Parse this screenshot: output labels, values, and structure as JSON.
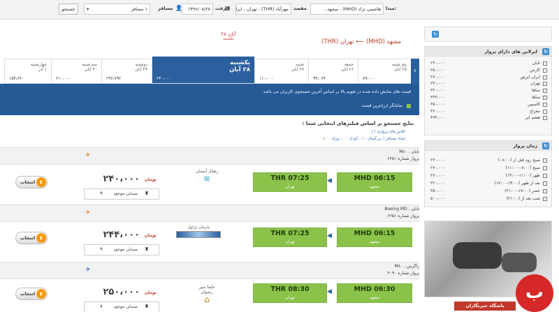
{
  "search": {
    "origin_label": "مبدا:",
    "origin_value": "هاشمی نژاد (MHD) ، مشهد ،",
    "dest_label": "مقصد",
    "dest_value": "مهرآباد (THR) ، تهران ، ایران",
    "depart_label": "رفت",
    "depart_value": "۱۳۹۶/۰۸/۲۸",
    "pax_label": "مسافر",
    "pax_value": "۱ مسافر",
    "search_button": "جستجو"
  },
  "route": {
    "title": "مشهد (MHD) ⟵ تهران (THR)",
    "date_day": "۲۸ آبان",
    "date_weekday": "یکشنبه"
  },
  "date_tabs": [
    {
      "weekday": "پنج شنبه",
      "date": "۲۵ آبان",
      "price": "۸۹،۰۰۰"
    },
    {
      "weekday": "جمعه",
      "date": "۲۶ آبان",
      "price": "۹۹،۰۶۴"
    },
    {
      "weekday": "شنبه",
      "date": "۲۷ آبان",
      "price": "۱۱۰،۰۰۰"
    },
    {
      "weekday": "یکشنبه",
      "date": "۲۸ آبان",
      "price": "۲۴۰،۰۰۰"
    },
    {
      "weekday": "دوشنبه",
      "date": "۲۹ آبان",
      "price": "۲۹۶،۷۹۲"
    },
    {
      "weekday": "سه شنبه",
      "date": "۳۰ آبان",
      "price": "۲۱۰،۰۰۰"
    },
    {
      "weekday": "چهارشنبه",
      "date": "۱ آذر",
      "price": "۱۵۴،۳۶۰"
    }
  ],
  "info": {
    "notice": "قیمت های نمایش داده شده در تقویم بالا بر اساس آخرین جستجوی کاربران می باشد.",
    "legend": "نمایانگر ارزانترین قیمت"
  },
  "results": {
    "heading": "نتایج جستجو بر اساس فیلترهای انتخابی شما :",
    "filter1": "کلاس های پروازی (  )",
    "filter2": "تعداد مسافر ( بزرگسال : ۱ ، کودک : ۰ ، نوزاد : ۰ )"
  },
  "flights": [
    {
      "aircraft": "تابان ، M۸۰",
      "flight_no": "پرواز شماره ۶۲۵۱",
      "airline": "رهبال آسمان",
      "dep_code": "MHD",
      "dep_time": "06:15",
      "dep_city": "مشهد",
      "arr_code": "THR",
      "arr_time": "07:25",
      "arr_city": "تهران",
      "price": "۲۴۰،۰۰۰",
      "currency": "تومان",
      "seats_label": "صندلی موجود",
      "seats": "۹",
      "select": "انتخاب"
    },
    {
      "aircraft": "تابان ، Boeing MD",
      "flight_no": "پرواز شماره ۶۲۵۱",
      "airline": "بارمان تراول",
      "dep_code": "MHD",
      "dep_time": "06:15",
      "dep_city": "مشهد",
      "arr_code": "THR",
      "arr_time": "07:25",
      "arr_city": "تهران",
      "price": "۲۴۴،۰۰۰",
      "currency": "تومان",
      "seats_label": "صندلی موجود",
      "seats": "۹",
      "select": "انتخاب"
    },
    {
      "aircraft": "زاگرس ، M۸۰",
      "flight_no": "پرواز شماره ۴۰۹۰",
      "airline": "حلما سیر رضوان",
      "dep_code": "MHD",
      "dep_time": "06:30",
      "dep_city": "مشهد",
      "arr_code": "THR",
      "arr_time": "08:30",
      "arr_city": "تهران",
      "price": "۲۵۰،۰۰۰",
      "currency": "تومان",
      "seats_label": "صندلی موجود",
      "seats": "۷",
      "select": "انتخاب"
    }
  ],
  "sidebar": {
    "airlines_title": "ایرلاین های دارای پرواز",
    "airlines": [
      {
        "name": "تابان",
        "price": "۲۴۰،۰۰۰"
      },
      {
        "name": "کارس",
        "price": "۲۵۰،۰۰۰"
      },
      {
        "name": "ایران ایرتور",
        "price": "۲۷۰،۰۰۰"
      },
      {
        "name": "تهران",
        "price": "۲۳۰،۰۰۰"
      },
      {
        "name": "ساها",
        "price": "۳۲۰،۰۰۰"
      },
      {
        "name": "ساها",
        "price": "۳۳۳،۰۰۰"
      },
      {
        "name": "کاسپین",
        "price": "۳۵۰،۰۰۰"
      },
      {
        "name": "معراج",
        "price": "۳۶۰،۰۰۰"
      },
      {
        "name": "هشم ایر",
        "price": "۴۷۴،۰۰۰"
      }
    ],
    "time_title": "زمان پرواز",
    "times": [
      {
        "name": "صبح زود قبل از (۰۸:۰۰)",
        "price": "۲۴۰،۰۰۰"
      },
      {
        "name": "صبح (۰۸:۰۰-۱۱:۰۰)",
        "price": "۲۷۰،۰۰۰"
      },
      {
        "name": "ظهر (۱۱:۰۰-۱۴:۰۰)",
        "price": "۲۷۰،۰۰۰"
      },
      {
        "name": "بعد از ظهر (۱۴:۰۰-۱۷:۰۰)",
        "price": "۳۲۰،۰۰۰"
      },
      {
        "name": "عصر (۱۷:۰۰-۲۱:۰۰)",
        "price": "۳۵۰،۰۰۰"
      },
      {
        "name": "شب بعد از (۲۱:۰۰)",
        "price": "۵۰۰،۰۰۰"
      }
    ]
  },
  "watermark": "باشگاه خبرنگاران"
}
